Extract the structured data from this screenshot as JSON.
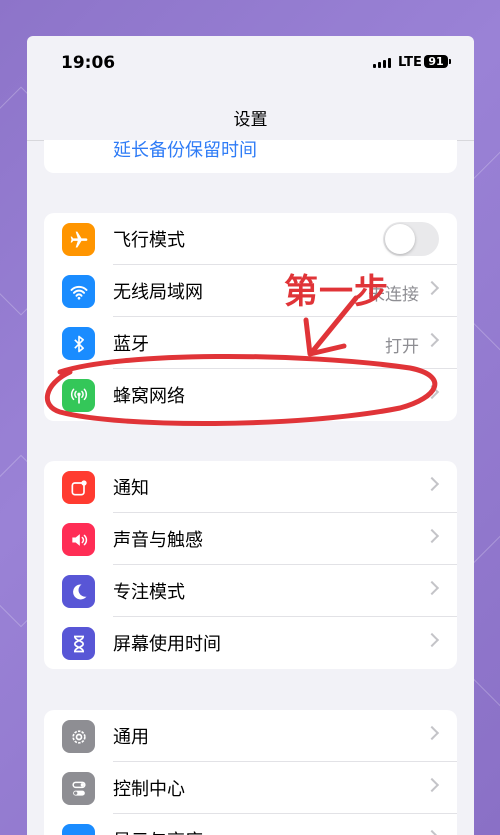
{
  "status_bar": {
    "time": "19:06",
    "network": "LTE",
    "battery": "91"
  },
  "nav": {
    "title": "设置"
  },
  "top_link": "延长备份保留时间",
  "group1": [
    {
      "label": "飞行模式",
      "icon": "airplane-icon",
      "color": "#ff9500"
    },
    {
      "label": "无线局域网",
      "value": "未连接",
      "icon": "wifi-icon",
      "color": "#1a8cff"
    },
    {
      "label": "蓝牙",
      "value": "打开",
      "icon": "bluetooth-icon",
      "color": "#1a8cff"
    },
    {
      "label": "蜂窝网络",
      "icon": "cellular-icon",
      "color": "#34c759"
    }
  ],
  "group2": [
    {
      "label": "通知",
      "icon": "notification-icon",
      "color": "#ff3b30"
    },
    {
      "label": "声音与触感",
      "icon": "sound-icon",
      "color": "#ff2d55"
    },
    {
      "label": "专注模式",
      "icon": "moon-icon",
      "color": "#5856d6"
    },
    {
      "label": "屏幕使用时间",
      "icon": "hourglass-icon",
      "color": "#5856d6"
    }
  ],
  "group3": [
    {
      "label": "通用",
      "icon": "gear-icon",
      "color": "#8e8e93"
    },
    {
      "label": "控制中心",
      "icon": "switches-icon",
      "color": "#8e8e93"
    },
    {
      "label": "显示与亮度",
      "icon": "brightness-icon",
      "color": "#1a8cff"
    }
  ],
  "annotation": {
    "text": "第一步",
    "color": "#e03438"
  }
}
